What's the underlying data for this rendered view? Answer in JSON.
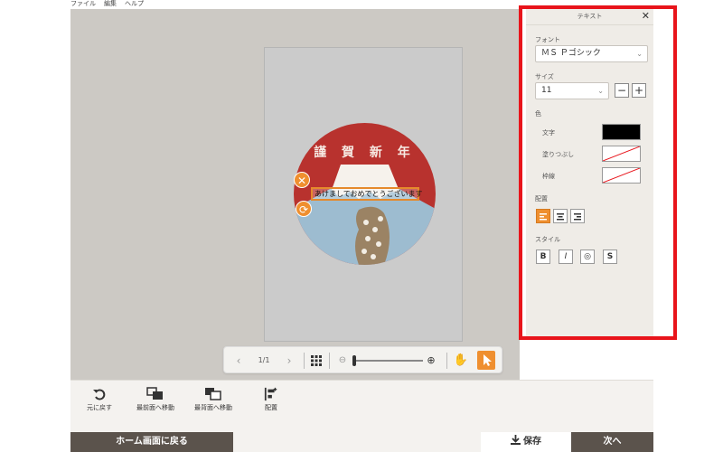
{
  "menu": [
    "ファイル",
    "編集",
    "ヘルプ"
  ],
  "card": {
    "title": "謹 賀 新 年",
    "text": "あけましておめでとうございます"
  },
  "nav": {
    "page": "1/1"
  },
  "tools": [
    {
      "label": "元に戻す"
    },
    {
      "label": "最前面へ移動"
    },
    {
      "label": "最背面へ移動"
    },
    {
      "label": "配置"
    }
  ],
  "footer": {
    "home": "ホーム画面に戻る",
    "save": "保存",
    "next": "次へ"
  },
  "panel": {
    "title": "テキスト",
    "font_label": "フォント",
    "font_value": "ＭＳ Ｐゴシック",
    "size_label": "サイズ",
    "size_value": "11",
    "color_label": "色",
    "text_color_label": "文字",
    "fill_label": "塗りつぶし",
    "border_label": "枠線",
    "align_label": "配置",
    "style_label": "スタイル",
    "style_buttons": [
      "B",
      "I",
      "◎",
      "S"
    ]
  },
  "colors": {
    "card_red": "#b8322e",
    "accent_orange": "#ef8f2f",
    "text_color": "#000000",
    "highlight": "#e8141b"
  }
}
